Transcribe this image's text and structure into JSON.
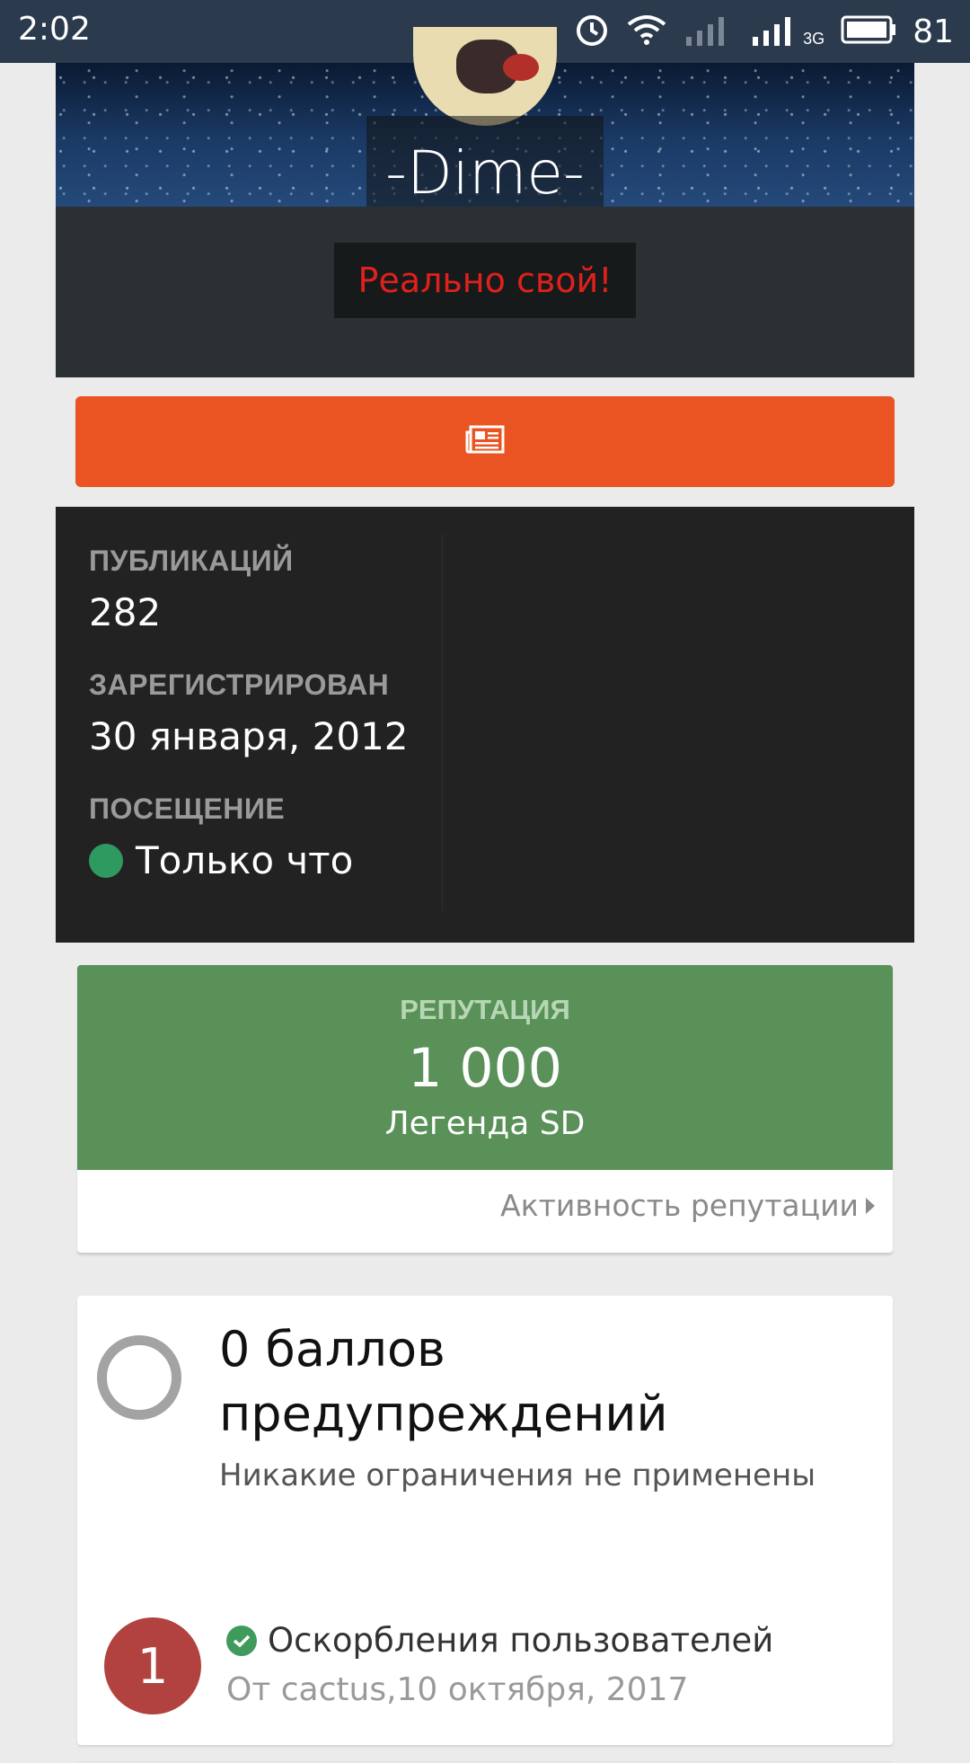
{
  "status_bar": {
    "time": "2:02",
    "battery": "81",
    "network": "3G"
  },
  "profile": {
    "name": "-Dime-",
    "title": "Реально свой!"
  },
  "stats": [
    {
      "label": "ПУБЛИКАЦИЙ",
      "value": "282"
    },
    {
      "label": "ЗАРЕГИСТРИРОВАН",
      "value": "30 января, 2012"
    },
    {
      "label": "ПОСЕЩЕНИЕ",
      "value": "Только что"
    }
  ],
  "reputation": {
    "label": "РЕПУТАЦИЯ",
    "value": "1 000",
    "rank": "Легенда SD",
    "activity_link": "Активность репутации"
  },
  "warnings": {
    "title": "0 баллов предупреждений",
    "subtitle": "Никакие ограничения не применены",
    "items": [
      {
        "points": "1",
        "reason": "Оскорбления пользователей",
        "meta": "От cactus,10 октября, 2017"
      }
    ]
  },
  "colors": {
    "status_bar": "#2b3a4d",
    "accent_button": "#ea5422",
    "reputation_green": "#5a9159",
    "warning_badge": "#b2423f",
    "title_red": "#e0201b",
    "online": "#2e9a5f"
  },
  "icons": {
    "orange_button": "newspaper-icon",
    "status": [
      "alarm-icon",
      "wifi-icon",
      "signal-icon",
      "battery-icon"
    ]
  }
}
